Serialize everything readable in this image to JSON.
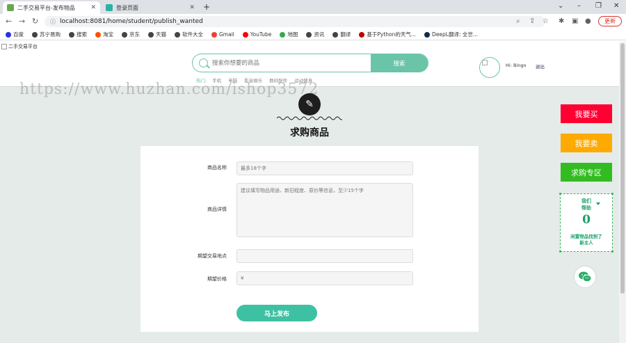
{
  "browser": {
    "tabs": [
      {
        "title": "二手交易平台-发布物品",
        "active": true,
        "favicon_color": "#6aa84f"
      },
      {
        "title": "登录页面",
        "active": false,
        "favicon_color": "#2bb3a6"
      }
    ],
    "url": "localhost:8081/home/student/publish_wanted",
    "update_label": "更新",
    "bookmarks": [
      {
        "label": "百度",
        "icon": "baidu-icon",
        "color": "#2932e1"
      },
      {
        "label": "苏宁易购",
        "icon": "globe-icon",
        "color": "#444444"
      },
      {
        "label": "搜索",
        "icon": "globe-icon",
        "color": "#444444"
      },
      {
        "label": "淘宝",
        "icon": "taobao-icon",
        "color": "#ff5000"
      },
      {
        "label": "京东",
        "icon": "globe-icon",
        "color": "#444444"
      },
      {
        "label": "天猫",
        "icon": "globe-icon",
        "color": "#444444"
      },
      {
        "label": "软件大全",
        "icon": "globe-icon",
        "color": "#444444"
      },
      {
        "label": "Gmail",
        "icon": "gmail-icon",
        "color": "#ea4335"
      },
      {
        "label": "YouTube",
        "icon": "youtube-icon",
        "color": "#ff0000"
      },
      {
        "label": "地图",
        "icon": "maps-icon",
        "color": "#34a853"
      },
      {
        "label": "资讯",
        "icon": "globe-icon",
        "color": "#444444"
      },
      {
        "label": "翻译",
        "icon": "globe-icon",
        "color": "#444444"
      },
      {
        "label": "基于Python的天气...",
        "icon": "h-icon",
        "color": "#c00000"
      },
      {
        "label": "DeepL翻译: 全世...",
        "icon": "deepl-icon",
        "color": "#0f2b46"
      }
    ]
  },
  "header": {
    "logo_alt": "二手交易平台",
    "search_placeholder": "搜索你想要的商品",
    "search_button": "搜索",
    "hot_label": "热门:",
    "hot_tags": [
      "手机",
      "电脑",
      "影音娱乐",
      "数码配件",
      "运动健身"
    ],
    "greeting": "Hi: Bingo",
    "logout": "退出"
  },
  "watermark": "https://www.huzhan.com/ishop3572",
  "form": {
    "title": "求购商品",
    "name_label": "商品名称",
    "name_placeholder": "最多18个字",
    "detail_label": "商品详情",
    "detail_placeholder": "建议填写物品用途、新旧程度、原价等信息，至少15个字",
    "location_label": "期望交易地点",
    "location_placeholder": "",
    "price_label": "期望价格",
    "price_prefix": "¥",
    "submit": "马上发布"
  },
  "sidebar": {
    "buy": {
      "label": "我要买",
      "color": "#ff0033"
    },
    "sell": {
      "label": "我要卖",
      "color": "#ffaa00"
    },
    "wanted": {
      "label": "求购专区",
      "color": "#33bb22"
    },
    "help": {
      "title": "我们\n帮助",
      "count": "0",
      "subtitle": "闲置物品找到了\n新主人"
    }
  },
  "colors": {
    "accent": "#69c4a8",
    "submit": "#3ec1a3",
    "main_bg": "#e4ebe8"
  }
}
